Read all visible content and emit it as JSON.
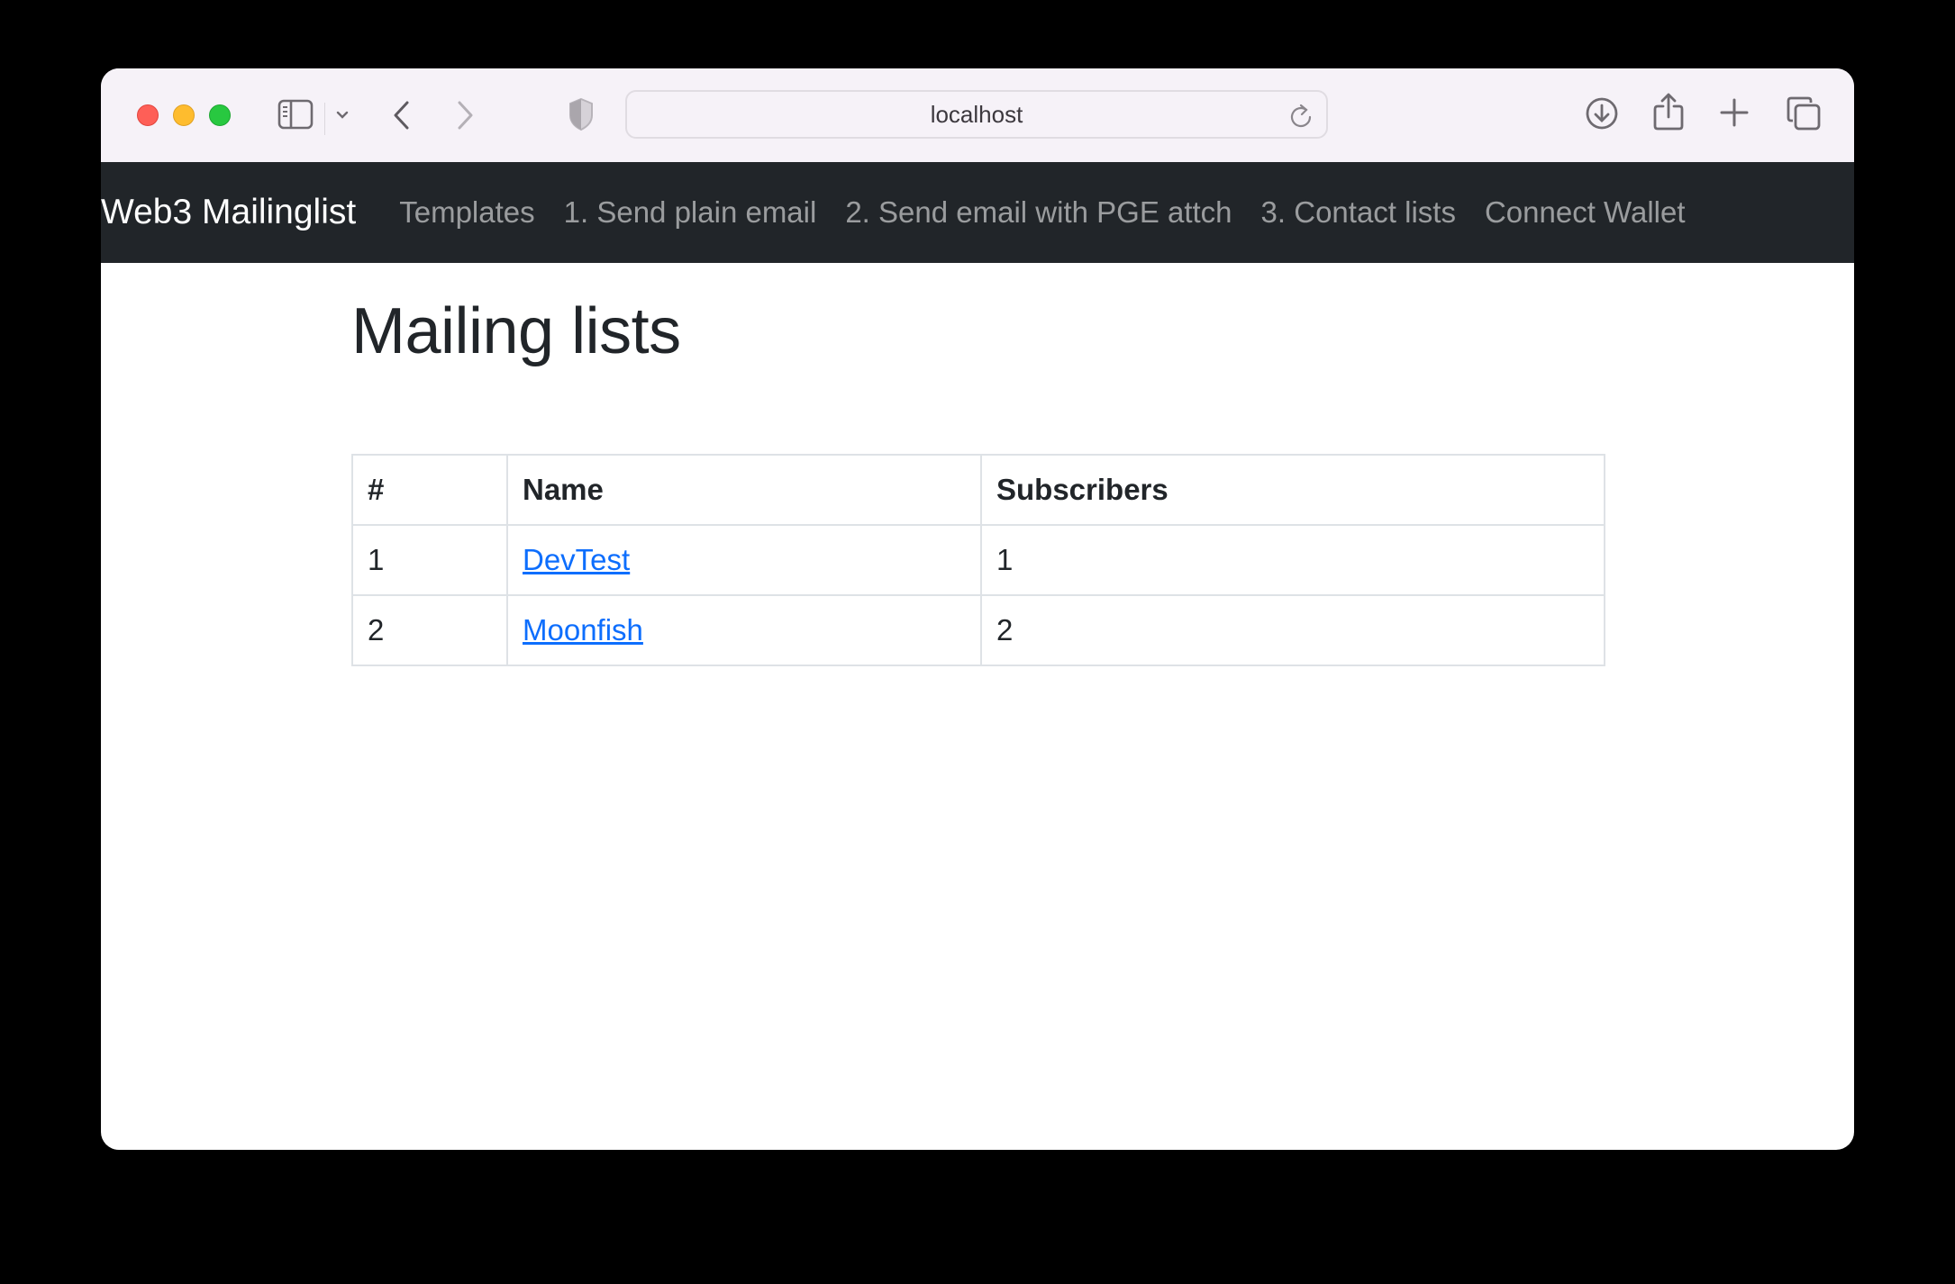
{
  "browser": {
    "url": "localhost",
    "icons": {
      "close": "close-window-icon",
      "minimize": "minimize-window-icon",
      "maximize": "maximize-window-icon",
      "sidebar": "sidebar-icon",
      "sidebar_menu": "chevron-down-icon",
      "back": "chevron-left-icon",
      "forward": "chevron-right-icon",
      "privacy": "shield-icon",
      "reload": "reload-icon",
      "downloads": "download-icon",
      "share": "share-icon",
      "new_tab": "plus-icon",
      "tabs": "tab-overview-icon"
    }
  },
  "navbar": {
    "brand": "Web3 Mailinglist",
    "links": [
      {
        "label": "Templates"
      },
      {
        "label": "1. Send plain email"
      },
      {
        "label": "2. Send email with PGE attch"
      },
      {
        "label": "3. Contact lists"
      },
      {
        "label": "Connect Wallet"
      }
    ]
  },
  "page": {
    "title": "Mailing lists",
    "table": {
      "headers": [
        "#",
        "Name",
        "Subscribers"
      ],
      "rows": [
        {
          "num": "1",
          "name": "DevTest",
          "subscribers": "1"
        },
        {
          "num": "2",
          "name": "Moonfish",
          "subscribers": "2"
        }
      ]
    }
  },
  "colors": {
    "navbar_bg": "#212529",
    "link": "#0d6efd",
    "toolbar_bg": "#f6f2f8"
  }
}
